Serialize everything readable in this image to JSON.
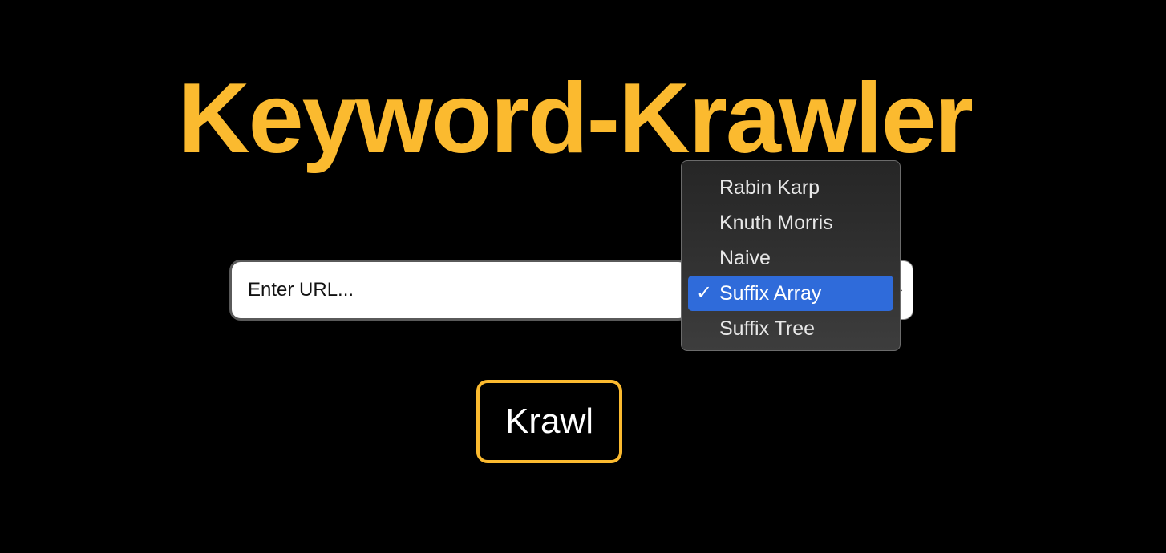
{
  "app": {
    "title": "Keyword-Krawler"
  },
  "colors": {
    "accent": "#FBBA2F",
    "background": "#000000",
    "selection": "#2F6BDA"
  },
  "search": {
    "placeholder": "Enter URL...",
    "value": ""
  },
  "algorithm_select": {
    "selected": "Suffix Array",
    "options": [
      {
        "label": "Rabin Karp",
        "checked": false
      },
      {
        "label": "Knuth Morris",
        "checked": false
      },
      {
        "label": "Naive",
        "checked": false
      },
      {
        "label": "Suffix Array",
        "checked": true
      },
      {
        "label": "Suffix Tree",
        "checked": false
      }
    ],
    "check_icon": "checkmark-icon",
    "check_glyph": "✓",
    "chevron_glyph": "⌄"
  },
  "actions": {
    "krawl_label": "Krawl"
  }
}
